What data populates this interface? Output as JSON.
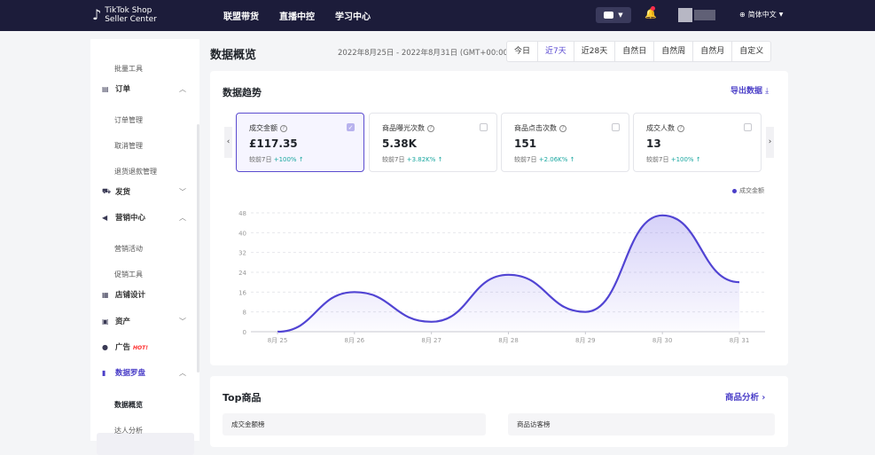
{
  "header": {
    "logo_line1": "TikTok Shop",
    "logo_line2": "Seller Center",
    "nav": [
      "联盟带货",
      "直播中控",
      "学习中心"
    ],
    "language": "简体中文"
  },
  "sidebar": {
    "items": [
      {
        "type": "sub",
        "label": "批量工具"
      },
      {
        "type": "group",
        "label": "订单",
        "icon": "order-icon",
        "arrow": "^"
      },
      {
        "type": "sub",
        "label": "订单管理"
      },
      {
        "type": "sub",
        "label": "取消管理"
      },
      {
        "type": "sub",
        "label": "退货退款管理"
      },
      {
        "type": "group",
        "label": "发货",
        "icon": "truck-icon",
        "arrow": "v"
      },
      {
        "type": "group",
        "label": "营销中心",
        "icon": "megaphone-icon",
        "arrow": "^"
      },
      {
        "type": "sub",
        "label": "营销活动"
      },
      {
        "type": "sub",
        "label": "促销工具"
      },
      {
        "type": "group",
        "label": "店铺设计",
        "icon": "shop-icon",
        "arrow": ""
      },
      {
        "type": "group",
        "label": "资产",
        "icon": "wallet-icon",
        "arrow": "v"
      },
      {
        "type": "group",
        "label": "广告",
        "icon": "ads-icon",
        "arrow": "",
        "badge": "HOT!"
      },
      {
        "type": "group",
        "label": "数据罗盘",
        "icon": "compass-chart-icon",
        "arrow": "^"
      },
      {
        "type": "sub",
        "label": "数据概览",
        "active": true
      },
      {
        "type": "sub",
        "label": "达人分析"
      }
    ]
  },
  "main": {
    "title": "数据概览",
    "date_range": "2022年8月25日 - 2022年8月31日 (GMT+00:00)",
    "ranges": [
      "今日",
      "近7天",
      "近28天",
      "自然日",
      "自然周",
      "自然月",
      "自定义"
    ],
    "active_range": "近7天",
    "trend_title": "数据趋势",
    "export_label": "导出数据",
    "metrics": [
      {
        "label": "成交金额",
        "value": "£117.35",
        "compare": "较前7日",
        "change": "+100%",
        "selected": true
      },
      {
        "label": "商品曝光次数",
        "value": "5.38K",
        "compare": "较前7日",
        "change": "+3.82K%",
        "selected": false
      },
      {
        "label": "商品点击次数",
        "value": "151",
        "compare": "较前7日",
        "change": "+2.06K%",
        "selected": false
      },
      {
        "label": "成交人数",
        "value": "13",
        "compare": "较前7日",
        "change": "+100%",
        "selected": false
      }
    ],
    "top_title": "Top商品",
    "analysis_label": "商品分析",
    "rank_left": "成交金额榜",
    "rank_right": "商品访客榜"
  },
  "chart_data": {
    "type": "area",
    "categories": [
      "8月 25",
      "8月 26",
      "8月 27",
      "8月 28",
      "8月 29",
      "8月 30",
      "8月 31"
    ],
    "series": [
      {
        "name": "成交金额",
        "values": [
          0,
          16,
          4,
          23,
          8,
          47,
          20
        ]
      }
    ],
    "yticks": [
      0,
      8,
      16,
      24,
      32,
      40,
      48
    ],
    "ylim": [
      0,
      48
    ],
    "legend": "top-right",
    "grid": true,
    "color": "#5144d3"
  },
  "colors": {
    "accent": "#4b3fc8",
    "topbar": "#1c1c3a",
    "positive": "#1aa7a0"
  }
}
